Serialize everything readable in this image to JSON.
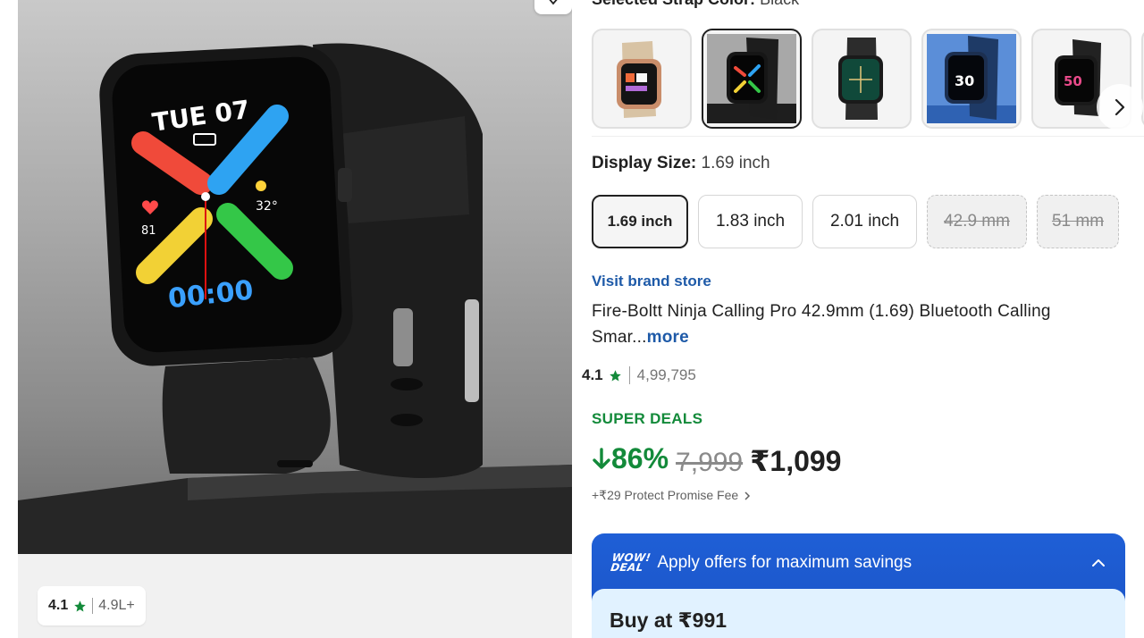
{
  "strap": {
    "label": "Selected Strap Color:",
    "value": "Black"
  },
  "display": {
    "label": "Display Size:",
    "value": "1.69 inch"
  },
  "sizes": [
    {
      "label": "1.69 inch",
      "state": "selected"
    },
    {
      "label": "1.83 inch",
      "state": "available"
    },
    {
      "label": "2.01 inch",
      "state": "available"
    },
    {
      "label": "42.9 mm",
      "state": "unavailable"
    },
    {
      "label": "51 mm",
      "state": "unavailable"
    }
  ],
  "swatches": [
    {
      "name": "beige-nylon"
    },
    {
      "name": "black",
      "selected": true
    },
    {
      "name": "black-mesh"
    },
    {
      "name": "blue"
    },
    {
      "name": "black-2"
    }
  ],
  "watch_face": {
    "day": "TUE 07",
    "time": "00:00",
    "heart_rate": "81",
    "temperature": "32°"
  },
  "image_rating": {
    "rating": "4.1",
    "count": "4.9L+"
  },
  "product": {
    "brand_link": "Visit brand store",
    "title": "Fire-Boltt Ninja Calling Pro 42.9mm (1.69) Bluetooth Calling Smar...",
    "more": "more",
    "rating": "4.1",
    "rating_count": "4,99,795"
  },
  "pricing": {
    "deal_label": "SUPER DEALS",
    "discount": "86%",
    "mrp": "7,999",
    "price": "₹1,099",
    "fee_text": "+₹29 Protect Promise Fee"
  },
  "offers": {
    "badge_line1": "WOW!",
    "badge_line2": "DEAL",
    "header": "Apply offers for maximum savings",
    "buy_at": "Buy at ₹991"
  },
  "colors": {
    "accent_green": "#138a3a",
    "link_blue": "#1e5aa8",
    "offer_blue": "#1f5fd6",
    "star_green": "#138a3a"
  }
}
